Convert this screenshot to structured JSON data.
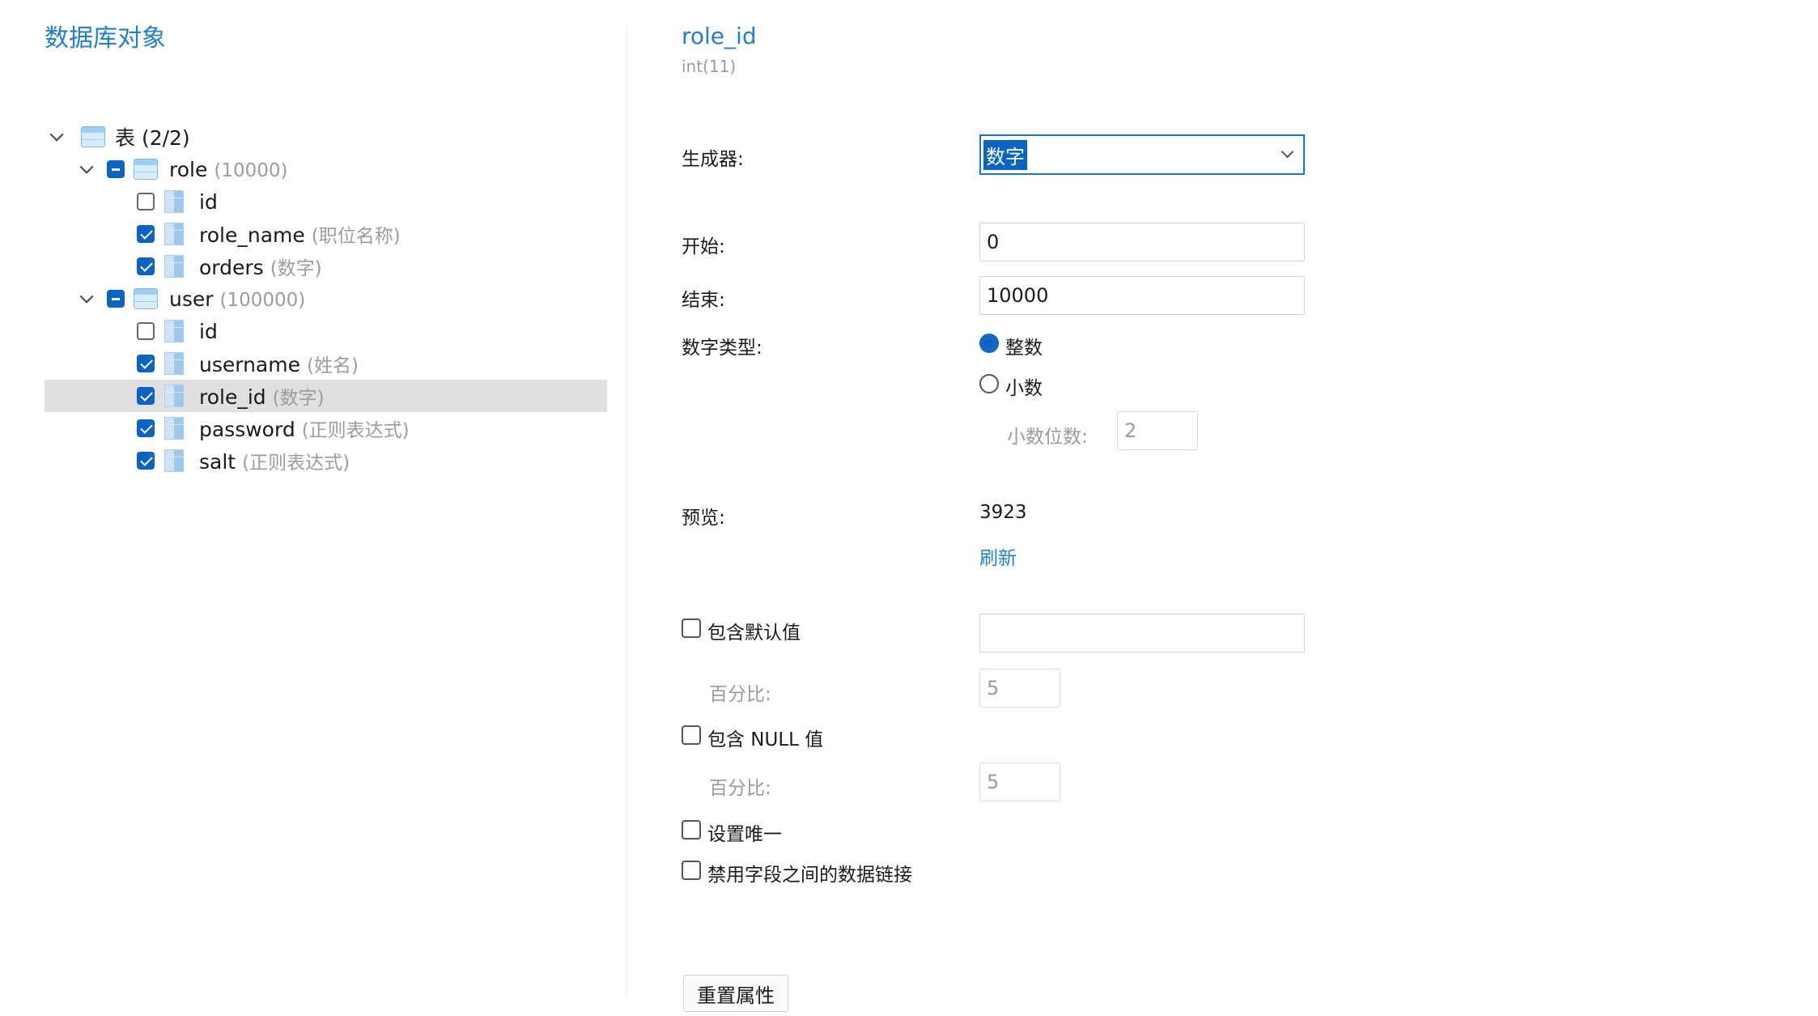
{
  "left_panel": {
    "title": "数据库对象",
    "root": {
      "label": "表 (2/2)"
    },
    "tables": [
      {
        "name": "role",
        "count": "(10000)",
        "columns": [
          {
            "name": "id",
            "note": "",
            "checked": false
          },
          {
            "name": "role_name",
            "note": "(职位名称)",
            "checked": true
          },
          {
            "name": "orders",
            "note": "(数字)",
            "checked": true
          }
        ]
      },
      {
        "name": "user",
        "count": "(100000)",
        "columns": [
          {
            "name": "id",
            "note": "",
            "checked": false
          },
          {
            "name": "username",
            "note": "(姓名)",
            "checked": true
          },
          {
            "name": "role_id",
            "note": "(数字)",
            "checked": true,
            "selected": true
          },
          {
            "name": "password",
            "note": "(正则表达式)",
            "checked": true
          },
          {
            "name": "salt",
            "note": "(正则表达式)",
            "checked": true
          }
        ]
      }
    ]
  },
  "detail": {
    "field_name": "role_id",
    "field_type": "int(11)",
    "generator_label": "生成器:",
    "generator_value": "数字",
    "start_label": "开始:",
    "start_value": "0",
    "end_label": "结束:",
    "end_value": "10000",
    "number_type_label": "数字类型:",
    "number_type_options": [
      "整数",
      "小数"
    ],
    "number_type_selected": "整数",
    "decimal_places_label": "小数位数:",
    "decimal_places_value": "2",
    "preview_label": "预览:",
    "preview_value": "3923",
    "refresh_link": "刷新",
    "include_default_label": "包含默认值",
    "include_default_value": "",
    "default_percent_label": "百分比:",
    "default_percent_value": "5",
    "include_null_label": "包含 NULL 值",
    "null_percent_label": "百分比:",
    "null_percent_value": "5",
    "unique_label": "设置唯一",
    "disable_link_label": "禁用字段之间的数据链接",
    "reset_button": "重置属性"
  },
  "colors": {
    "accent": "#1f7fd0",
    "checkbox": "#0a64c4",
    "selected_row": "#e0e0e0"
  },
  "icons": [
    "chevron-down-icon",
    "table-icon",
    "column-icon",
    "checkbox",
    "radio",
    "dropdown-caret-icon"
  ]
}
